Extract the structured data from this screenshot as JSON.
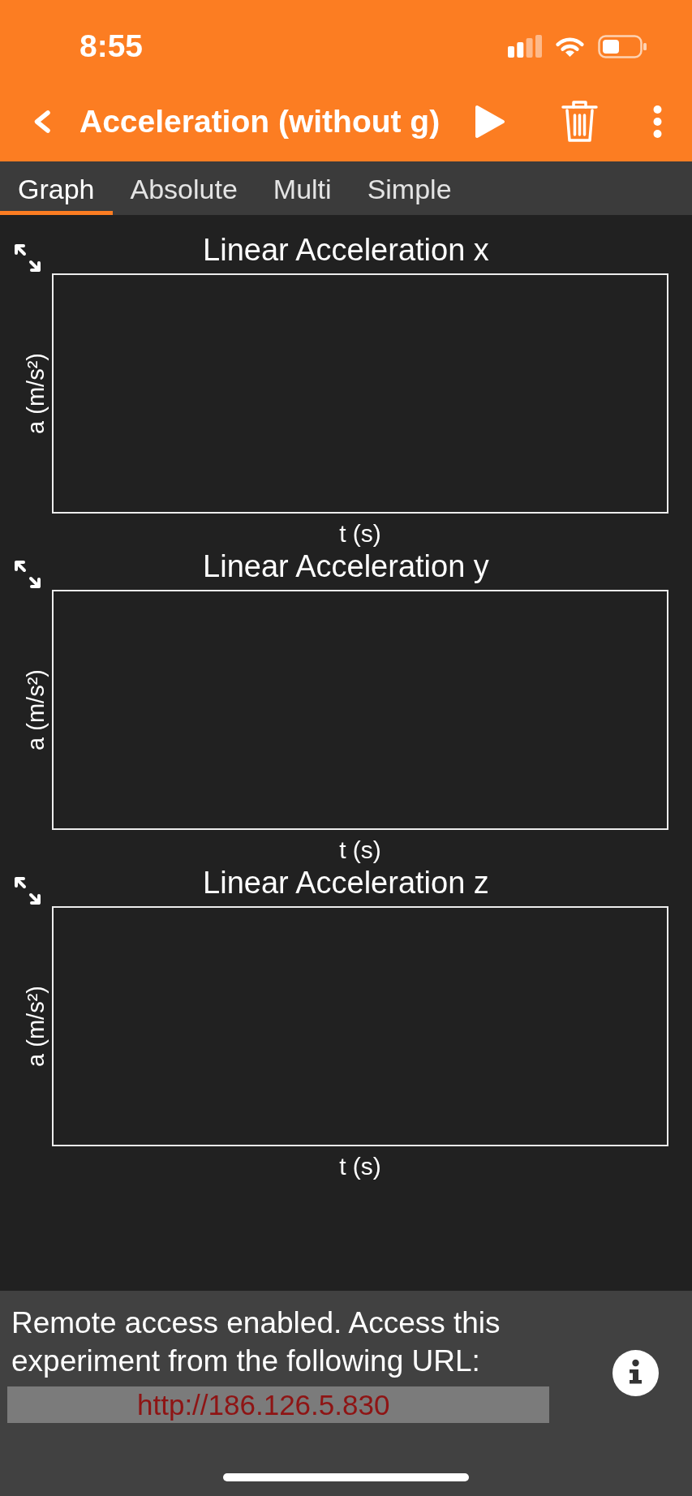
{
  "status_bar": {
    "time": "8:55"
  },
  "toolbar": {
    "title": "Acceleration (without g)"
  },
  "tabs": [
    {
      "label": "Graph",
      "selected": true
    },
    {
      "label": "Absolute",
      "selected": false
    },
    {
      "label": "Multi",
      "selected": false
    },
    {
      "label": "Simple",
      "selected": false
    }
  ],
  "graphs": [
    {
      "title": "Linear Acceleration x",
      "ylabel": "a (m/s²)",
      "xlabel": "t (s)"
    },
    {
      "title": "Linear Acceleration y",
      "ylabel": "a (m/s²)",
      "xlabel": "t (s)"
    },
    {
      "title": "Linear Acceleration z",
      "ylabel": "a (m/s²)",
      "xlabel": "t (s)"
    }
  ],
  "remote_access": {
    "message": "Remote access enabled. Access this experiment from the following URL:",
    "url": "http://186.126.5.830"
  }
}
